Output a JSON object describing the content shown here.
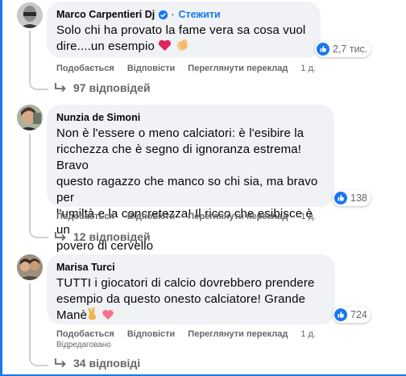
{
  "colors": {
    "accent": "#1877f2",
    "bubble": "#f0f2f5",
    "muted": "#65676b",
    "line": "#ced0d4"
  },
  "comments": [
    {
      "author": "Marco Carpentieri Dj",
      "verified_icon": "verified-badge-icon",
      "follow_label": "Стежити",
      "text_lines": [
        "Solo chi ha provato la fame vera sa cosa vuol",
        "dire....un esempio"
      ],
      "emojis": [
        "red-heart-emoji",
        "clapping-hands-emoji"
      ],
      "reactions_count": "2,7 тис.",
      "actions": {
        "like": "Подобається",
        "reply": "Відповісти",
        "translate": "Переглянути переклад",
        "time": "1 д."
      },
      "replies_label": "97 відповідей"
    },
    {
      "author": "Nunzia de Simoni",
      "text_lines": [
        "Non è l'essere o meno calciatori: è l'esibire la",
        "ricchezza che è segno di ignoranza estrema! Bravo",
        "questo ragazzo che manco so chi sia, ma bravo per",
        "l'umiltà e la concretezza! Il ricco che esibisce è un",
        "povero di cervello"
      ],
      "reactions_count": "138",
      "actions": {
        "like": "Подобається",
        "reply": "Відповісти",
        "translate": "Переглянути переклад",
        "time": "1 д."
      },
      "replies_label": "12 відповідей"
    },
    {
      "author": "Marisa Turci",
      "text_lines": [
        "TUTTI i giocatori di calcio dovrebbero prendere",
        "esempio da questo onesto calciatore! Grande",
        "Manè"
      ],
      "emojis": [
        "victory-hand-emoji",
        "sparkling-heart-emoji"
      ],
      "reactions_count": "724",
      "actions": {
        "like": "Подобається",
        "reply": "Відповісти",
        "translate": "Переглянути переклад",
        "time": "1 д."
      },
      "edited_label": "Відредаговано",
      "replies_label": "34 відповіді"
    }
  ]
}
